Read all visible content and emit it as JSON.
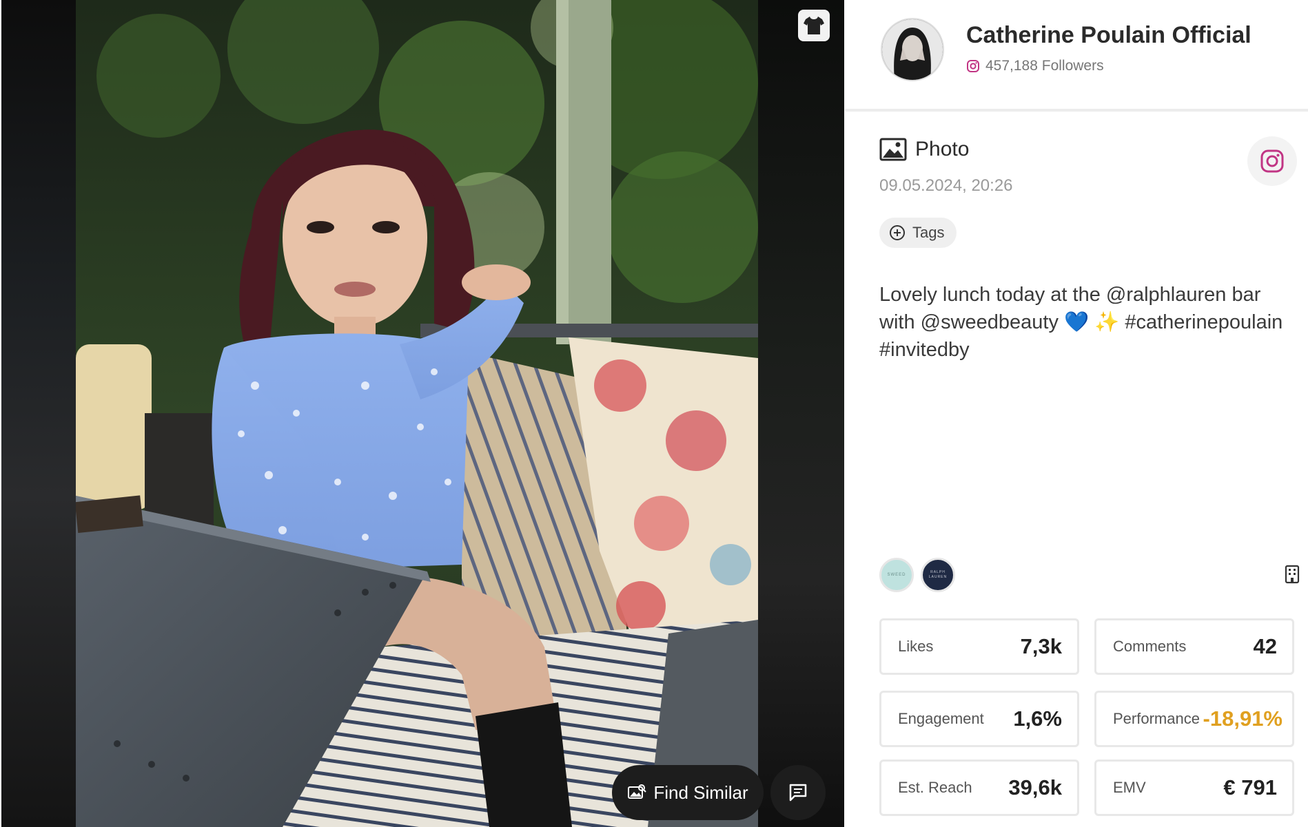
{
  "media": {
    "find_similar_label": "Find Similar",
    "shirt_icon": "tshirt-icon",
    "comment_icon": "comment-icon"
  },
  "profile": {
    "name": "Catherine Poulain Official",
    "followers": "457,188 Followers",
    "platform_icon": "instagram-icon",
    "platform_color": "#c13584"
  },
  "post": {
    "type_label": "Photo",
    "type_icon": "image-icon",
    "timestamp": "09.05.2024, 20:26",
    "tags_label": "Tags",
    "caption_line1": "Lovely lunch today at the @ralphlauren bar",
    "caption_line2": "with @sweedbeauty 💙 ✨ #catherinepoulain",
    "caption_line3": "#invitedby"
  },
  "brands": [
    {
      "name": "SWEED",
      "bg": "#bfe2df"
    },
    {
      "name": "RALPH LAUREN",
      "bg": "#1f2a44"
    }
  ],
  "stats": {
    "likes": {
      "label": "Likes",
      "value": "7,3k"
    },
    "comments": {
      "label": "Comments",
      "value": "42"
    },
    "engagement": {
      "label": "Engagement",
      "value": "1,6%"
    },
    "performance": {
      "label": "Performance",
      "value": "-18,91%"
    },
    "reach": {
      "label": "Est. Reach",
      "value": "39,6k"
    },
    "emv": {
      "label": "EMV",
      "value": "€ 791"
    }
  },
  "colors": {
    "accent_negative": "#e0a020",
    "dark_button": "#1d1d1d"
  }
}
